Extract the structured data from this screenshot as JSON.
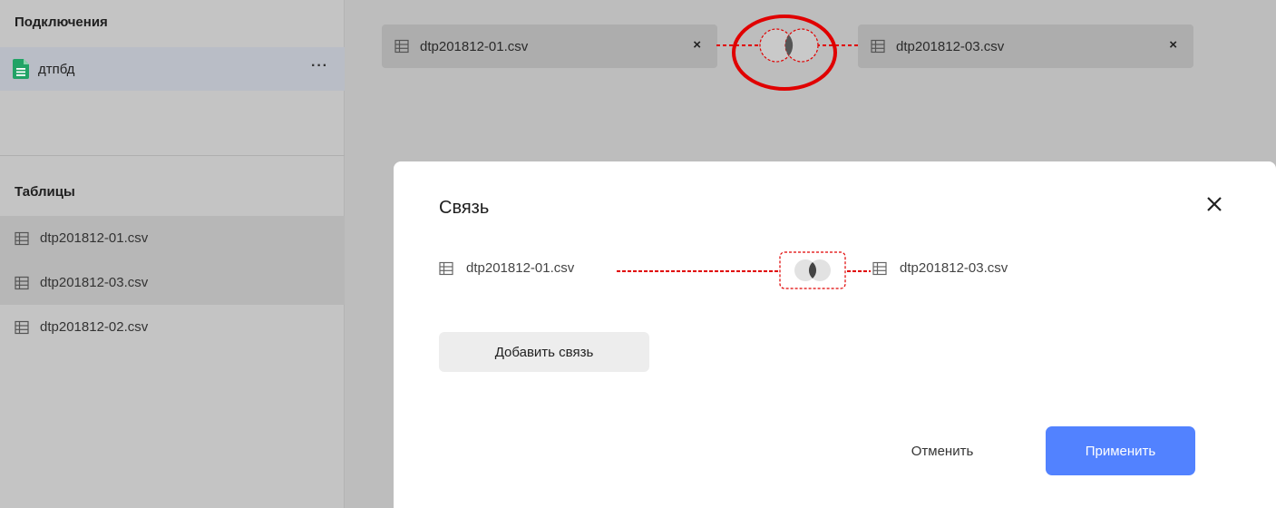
{
  "sidebar": {
    "connections_title": "Подключения",
    "connection": {
      "name": "дтпбд",
      "more": "···"
    },
    "tables_title": "Таблицы",
    "tables": [
      {
        "name": "dtp201812-01.csv",
        "selected": true
      },
      {
        "name": "dtp201812-03.csv",
        "selected": true
      },
      {
        "name": "dtp201812-02.csv",
        "selected": false
      }
    ]
  },
  "canvas": {
    "left_table": "dtp201812-01.csv",
    "right_table": "dtp201812-03.csv",
    "remove_icon": "×"
  },
  "modal": {
    "title": "Связь",
    "left_table": "dtp201812-01.csv",
    "right_table": "dtp201812-03.csv",
    "add_link": "Добавить связь",
    "cancel": "Отменить",
    "apply": "Применить"
  },
  "colors": {
    "accent": "#5282ff",
    "annotation": "#e00000",
    "sheet_green": "#21a366"
  }
}
